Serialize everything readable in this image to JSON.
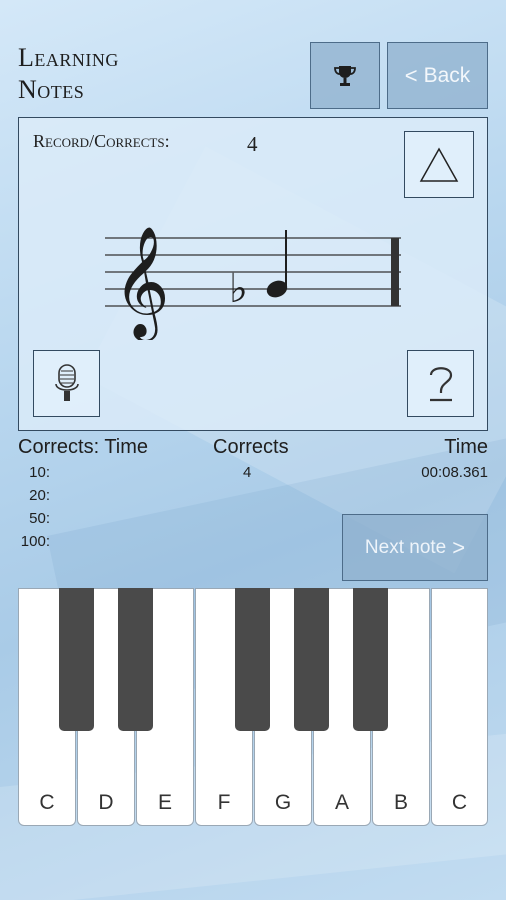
{
  "header": {
    "title_line1": "Learning",
    "title_line2": "Notes",
    "back_label": "Back",
    "back_chevron": "<"
  },
  "panel": {
    "record_label": "Record/Corrects:",
    "record_value": "4",
    "staff": {
      "clef": "treble",
      "note": "B flat quarter note",
      "accidental": "flat"
    }
  },
  "stats": {
    "header_left": "Corrects: Time",
    "header_mid": "Corrects",
    "header_right": "Time",
    "rows": [
      "10:",
      "20:",
      "50:",
      "100:"
    ],
    "corrects_value": "4",
    "time_value": "00:08.361"
  },
  "next_button": {
    "label": "Next note",
    "chevron": ">"
  },
  "piano": {
    "white_keys": [
      "C",
      "D",
      "E",
      "F",
      "G",
      "A",
      "B",
      "C"
    ]
  },
  "icons": {
    "trophy": "trophy-icon",
    "triangle": "triangle-icon",
    "microphone": "microphone-icon",
    "help": "question-icon"
  },
  "colors": {
    "button_fill": "#8fb0ce",
    "panel_border": "#334a60",
    "black_key": "#4a4a4a"
  }
}
